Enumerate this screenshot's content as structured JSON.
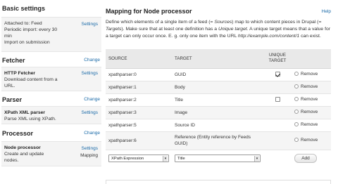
{
  "sidebar": {
    "basic": {
      "heading": "Basic settings",
      "lines": [
        "Attached to: Feed",
        "Periodic import: every 30",
        "min",
        "Import on submission"
      ],
      "link": "Settings"
    },
    "fetcher": {
      "heading": "Fetcher",
      "change": "Change",
      "name": "HTTP Fetcher",
      "lines": [
        "Download content from a",
        "URL."
      ],
      "link": "Settings"
    },
    "parser": {
      "heading": "Parser",
      "change": "Change",
      "name": "XPath XML parser",
      "lines": [
        "Parse XML using XPath."
      ],
      "link": "Settings"
    },
    "processor": {
      "heading": "Processor",
      "change": "Change",
      "name": "Node processor",
      "lines": [
        "Create and update",
        "nodes."
      ],
      "link": "Settings",
      "plain": "Mapping"
    }
  },
  "main": {
    "title": "Mapping for Node processor",
    "help": "Help",
    "description": {
      "p1": "Define which elements of a single item of a feed (= ",
      "sources": "Sources",
      "p2": ") map to which content pieces in Drupal (= ",
      "targets": "Targets",
      "p3": "). Make sure that at least one definition has a ",
      "unique": "Unique target",
      "p4": ". A unique target means that a value for a target can only occur once. E. g. only one item with the URL ",
      "url": "http://example.com/content/1",
      "p5": " can exist."
    },
    "table": {
      "headers": {
        "source": "SOURCE",
        "target": "TARGET",
        "unique_l1": "UNIQUE",
        "unique_l2": "TARGET"
      },
      "rows": [
        {
          "source": "xpathparser:0",
          "target": "GUID",
          "unique": "checked",
          "remove": "Remove"
        },
        {
          "source": "xpathparser:1",
          "target": "Body",
          "unique": "none",
          "remove": "Remove"
        },
        {
          "source": "xpathparser:2",
          "target": "Title",
          "unique": "unchecked",
          "remove": "Remove"
        },
        {
          "source": "xpathparser:3",
          "target": "Image",
          "unique": "none",
          "remove": "Remove"
        },
        {
          "source": "xpathparser:5",
          "target": "Source ID",
          "unique": "none",
          "remove": "Remove"
        },
        {
          "source": "xpathparser:6",
          "target_l1": "Reference (Entity reference by Feeds",
          "target_l2": "GUID)",
          "unique": "none",
          "remove": "Remove"
        }
      ],
      "add_row": {
        "source_select": "XPath Expression",
        "target_select": "Title",
        "add_button": "Add"
      }
    }
  }
}
